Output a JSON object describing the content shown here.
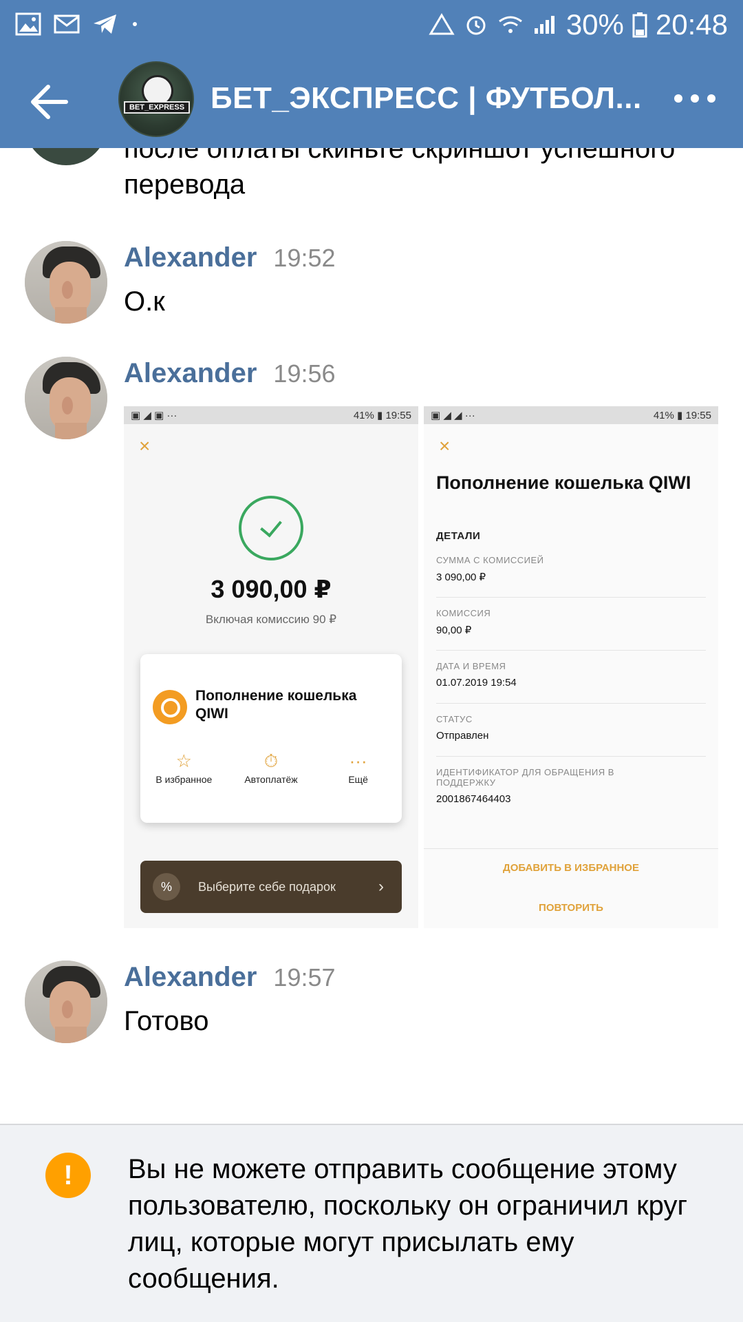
{
  "status_bar": {
    "battery": "30%",
    "time": "20:48"
  },
  "header": {
    "title": "БЕТ_ЭКСПРЕСС | ФУТБОЛ...",
    "group_avatar_text": "BET_EXPRESS"
  },
  "messages": {
    "cut_text": "после оплаты скиньте скриншот успешного перевода",
    "m1": {
      "author": "Alexander",
      "time": "19:52",
      "text": "О.к"
    },
    "m2": {
      "author": "Alexander",
      "time": "19:56"
    },
    "m3": {
      "author": "Alexander",
      "time": "19:57",
      "text": "Готово"
    }
  },
  "attachment_left": {
    "status_left": "▣ ◢ ▣ ···",
    "status_right": "41% ▮ 19:55",
    "close": "×",
    "amount": "3 090,00 ₽",
    "commission": "Включая комиссию 90 ₽",
    "card_title": "Пополнение кошелька QIWI",
    "actions": [
      {
        "icon": "☆",
        "label": "В избранное"
      },
      {
        "icon": "⏱",
        "label": "Автоплатёж"
      },
      {
        "icon": "···",
        "label": "Ещё"
      }
    ],
    "gift_icon": "%",
    "gift_label": "Выберите себе подарок",
    "gift_arrow": "›"
  },
  "attachment_right": {
    "status_left": "▣ ◢ ◢ ···",
    "status_right": "41% ▮ 19:55",
    "close": "×",
    "title": "Пополнение кошелька QIWI",
    "section": "ДЕТАЛИ",
    "items": [
      {
        "key": "СУММА С КОМИССИЕЙ",
        "value": "3 090,00 ₽"
      },
      {
        "key": "КОМИССИЯ",
        "value": "90,00 ₽"
      },
      {
        "key": "ДАТА И ВРЕМЯ",
        "value": "01.07.2019 19:54"
      },
      {
        "key": "СТАТУС",
        "value": "Отправлен"
      },
      {
        "key": "ИДЕНТИФИКАТОР ДЛЯ ОБРАЩЕНИЯ В ПОДДЕРЖКУ",
        "value": "2001867464403"
      }
    ],
    "add_favorite": "ДОБАВИТЬ В ИЗБРАННОЕ",
    "repeat": "ПОВТОРИТЬ"
  },
  "notice": {
    "icon": "!",
    "text": "Вы не можете отправить сообщение этому пользователю, поскольку он ограничил круг лиц, которые могут присылать ему сообщения."
  },
  "colors": {
    "header_bg": "#5181b8",
    "author": "#4a6f9a",
    "warning": "#ffa000",
    "qiwi_orange": "#f39c22",
    "success_green": "#3aa85f"
  }
}
